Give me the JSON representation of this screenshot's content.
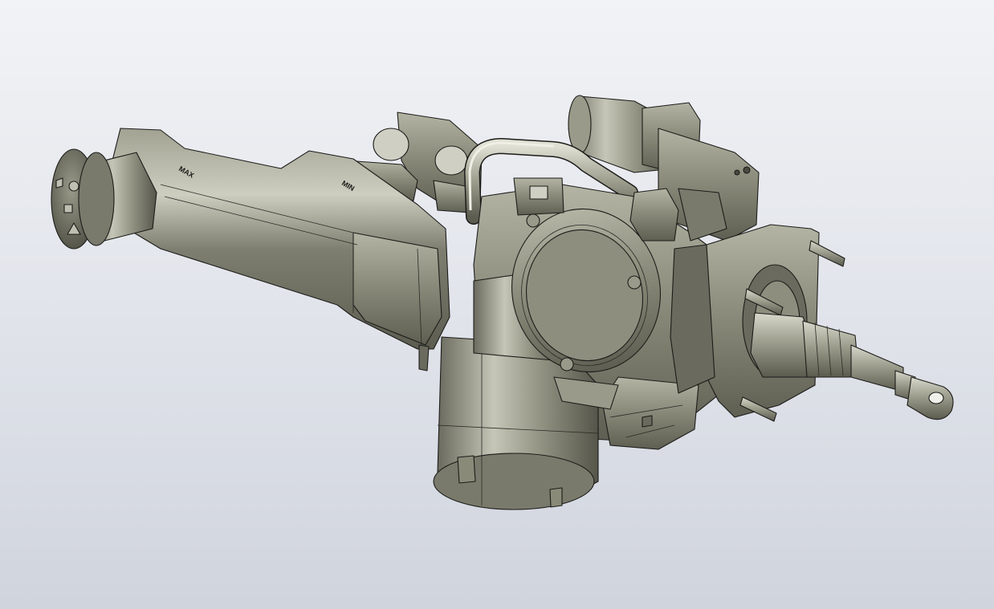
{
  "viewport": {
    "background_top": "#f2f3f6",
    "background_bottom": "#d0d4dd"
  },
  "model": {
    "subject": "3d-cad-assembly",
    "body_color": "#8a8a78",
    "highlight_color": "#c8c8ba",
    "shadow_color": "#55554a",
    "edge_color": "#1c1c1a",
    "reservoir_markings": [
      "MAX",
      "MIN"
    ]
  }
}
